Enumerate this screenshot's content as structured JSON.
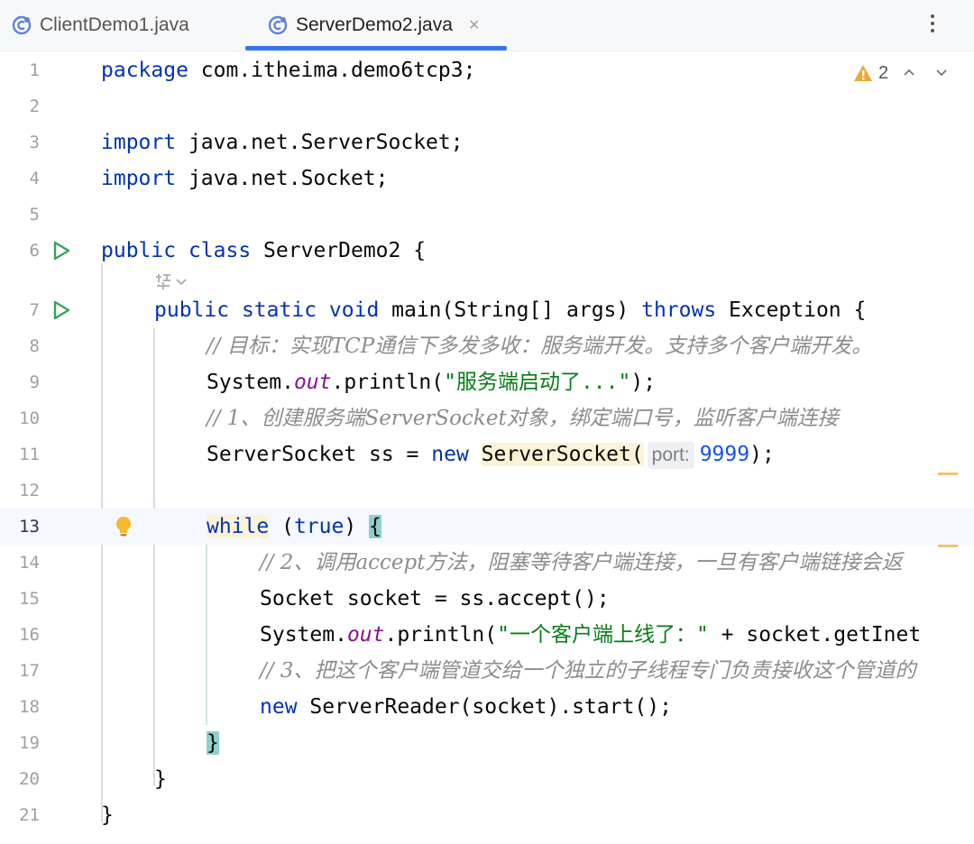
{
  "tabs": [
    {
      "label": "ClientDemo1.java",
      "active": false
    },
    {
      "label": "ServerDemo2.java",
      "active": true,
      "close": "×"
    }
  ],
  "editor": {
    "warning_count": "2",
    "current_line": 13,
    "line_numbers": [
      "1",
      "2",
      "3",
      "4",
      "5",
      "6",
      "7",
      "8",
      "9",
      "10",
      "11",
      "12",
      "13",
      "14",
      "15",
      "16",
      "17",
      "18",
      "19",
      "20",
      "21"
    ],
    "code": {
      "l1": [
        "package",
        " com.itheima.demo6tcp3;"
      ],
      "l3": [
        "import",
        " java.net.ServerSocket;"
      ],
      "l4": [
        "import",
        " java.net.Socket;"
      ],
      "l6": [
        "public",
        " ",
        "class",
        " ServerDemo2 {"
      ],
      "l7": [
        "public",
        " ",
        "static",
        " ",
        "void",
        " main(String[] args) ",
        "throws",
        " Exception {"
      ],
      "l8": "// 目标：实现TCP通信下多发多收：服务端开发。支持多个客户端开发。",
      "l9": [
        "System.",
        "out",
        ".println(",
        "\"服务端启动了...\"",
        ");"
      ],
      "l10": "// 1、创建服务端ServerSocket对象，绑定端口号，监听客户端连接",
      "l11": [
        "ServerSocket ss = ",
        "new",
        " ",
        "ServerSocket(",
        "port:",
        "9999",
        ");"
      ],
      "l13": [
        "while",
        " (",
        "true",
        ") ",
        "{"
      ],
      "l14": "// 2、调用accept方法，阻塞等待客户端连接，一旦有客户端链接会返",
      "l15": "Socket socket = ss.accept();",
      "l16": [
        "System.",
        "out",
        ".println(",
        "\"一个客户端上线了：\"",
        " + socket.getInet"
      ],
      "l17": "// 3、把这个客户端管道交给一个独立的子线程专门负责接收这个管道的",
      "l18": [
        "new",
        " ServerReader(socket).start();"
      ],
      "l19": "}",
      "l20": "}",
      "l21": "}"
    }
  },
  "colors": {
    "keyword": "#0033b3",
    "string": "#067d17",
    "number": "#1750eb",
    "comment": "#8c8c8c",
    "static_field": "#871094",
    "tab_underline": "#3574f0",
    "brace_match": "#8fd0cf"
  },
  "icons": {
    "file_tab": "java-class-icon",
    "run_gutter": "run-triangle-icon",
    "intention": "lightbulb-icon",
    "problems": "warning-triangle-icon"
  }
}
